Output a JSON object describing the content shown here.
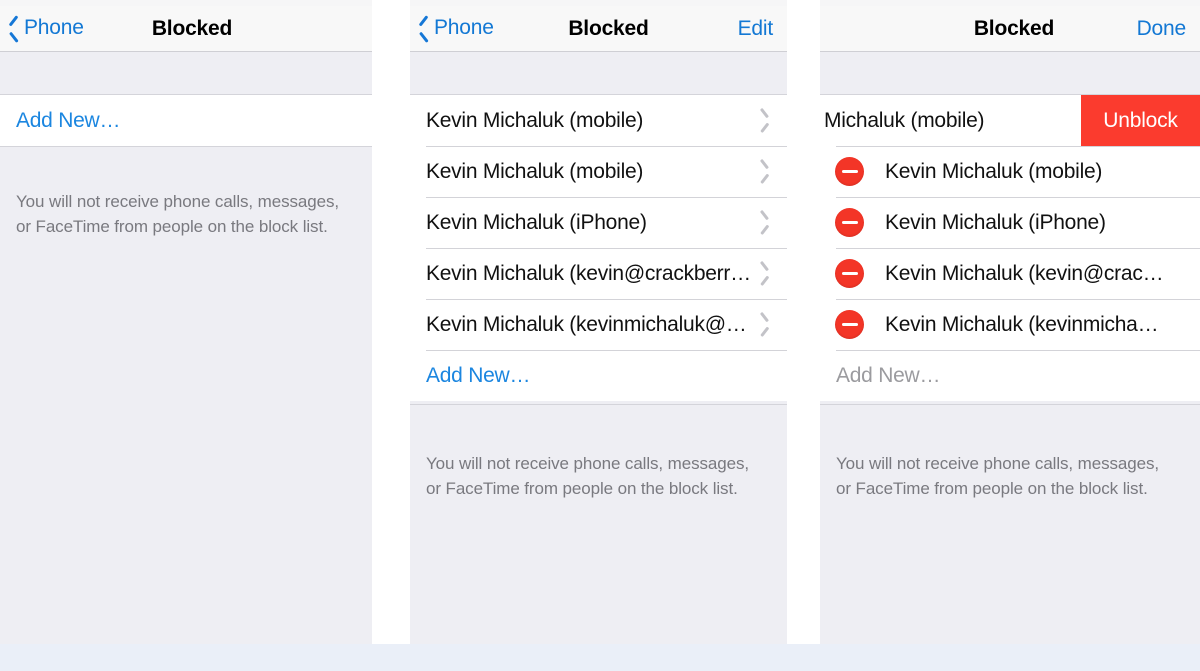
{
  "footer_note": {
    "line1": "You will not receive phone calls, messages,",
    "line2": "or FaceTime from people on the block list."
  },
  "panels": [
    {
      "id": "empty-state",
      "navbar": {
        "back_label": "Phone",
        "title": "Blocked",
        "action_label": ""
      },
      "rows": [
        {
          "label": "Add New…",
          "style": "link",
          "accessory": "none"
        }
      ]
    },
    {
      "id": "list-state",
      "navbar": {
        "back_label": "Phone",
        "title": "Blocked",
        "action_label": "Edit"
      },
      "rows": [
        {
          "label": "Kevin Michaluk (mobile)",
          "style": "plain",
          "accessory": "chevron-right"
        },
        {
          "label": "Kevin Michaluk (mobile)",
          "style": "plain",
          "accessory": "chevron-right"
        },
        {
          "label": "Kevin Michaluk (iPhone)",
          "style": "plain",
          "accessory": "chevron-right"
        },
        {
          "label": "Kevin Michaluk (kevin@crackberr…",
          "style": "plain",
          "accessory": "chevron-right"
        },
        {
          "label": "Kevin Michaluk (kevinmichaluk@…",
          "style": "plain",
          "accessory": "chevron-right"
        },
        {
          "label": "Add New…",
          "style": "link",
          "accessory": "none"
        }
      ]
    },
    {
      "id": "edit-state",
      "navbar": {
        "back_label": "",
        "title": "Blocked",
        "action_label": "Done"
      },
      "swipe_action_label": "Unblock",
      "rows": [
        {
          "label": "Michaluk (mobile)",
          "style": "swiped",
          "accessory": "unblock"
        },
        {
          "label": "Kevin Michaluk (mobile)",
          "style": "editing",
          "accessory": "delete-badge"
        },
        {
          "label": "Kevin Michaluk (iPhone)",
          "style": "editing",
          "accessory": "delete-badge"
        },
        {
          "label": "Kevin Michaluk (kevin@crac…",
          "style": "editing",
          "accessory": "delete-badge"
        },
        {
          "label": "Kevin Michaluk (kevinmicha…",
          "style": "editing",
          "accessory": "delete-badge"
        },
        {
          "label": "Add New…",
          "style": "disabled",
          "accessory": "none"
        }
      ]
    }
  ],
  "colors": {
    "accent_blue": "#1378d4",
    "destructive_red": "#fb3b2e",
    "badge_red": "#f33527",
    "panel_background": "#eeeef3",
    "row_background": "#ffffff",
    "separator": "#d3d3d8",
    "footer_text": "#79797f",
    "disabled_text": "#9b9b9f",
    "page_band": "#eaeff8"
  }
}
